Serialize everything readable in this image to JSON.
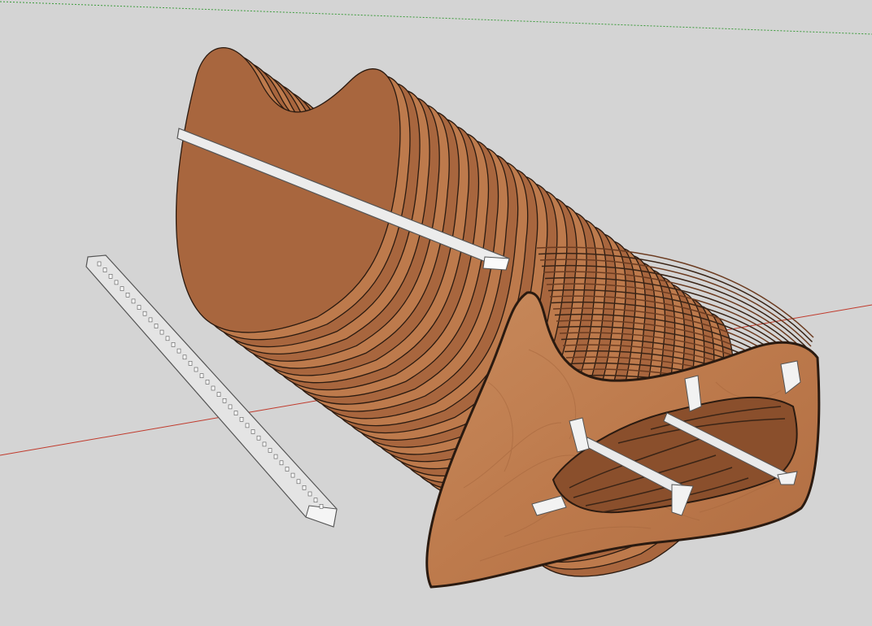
{
  "viewport": {
    "background": "#d4d4d4",
    "axis_red": "#c0392b",
    "axis_green": "#3a9a3a"
  },
  "model": {
    "wood_light": "#c07a4e",
    "wood_dark": "#8a4f2c",
    "wood_edge": "#3a2416",
    "brace_color": "#e9e9e9",
    "brace_edge": "#555555"
  }
}
